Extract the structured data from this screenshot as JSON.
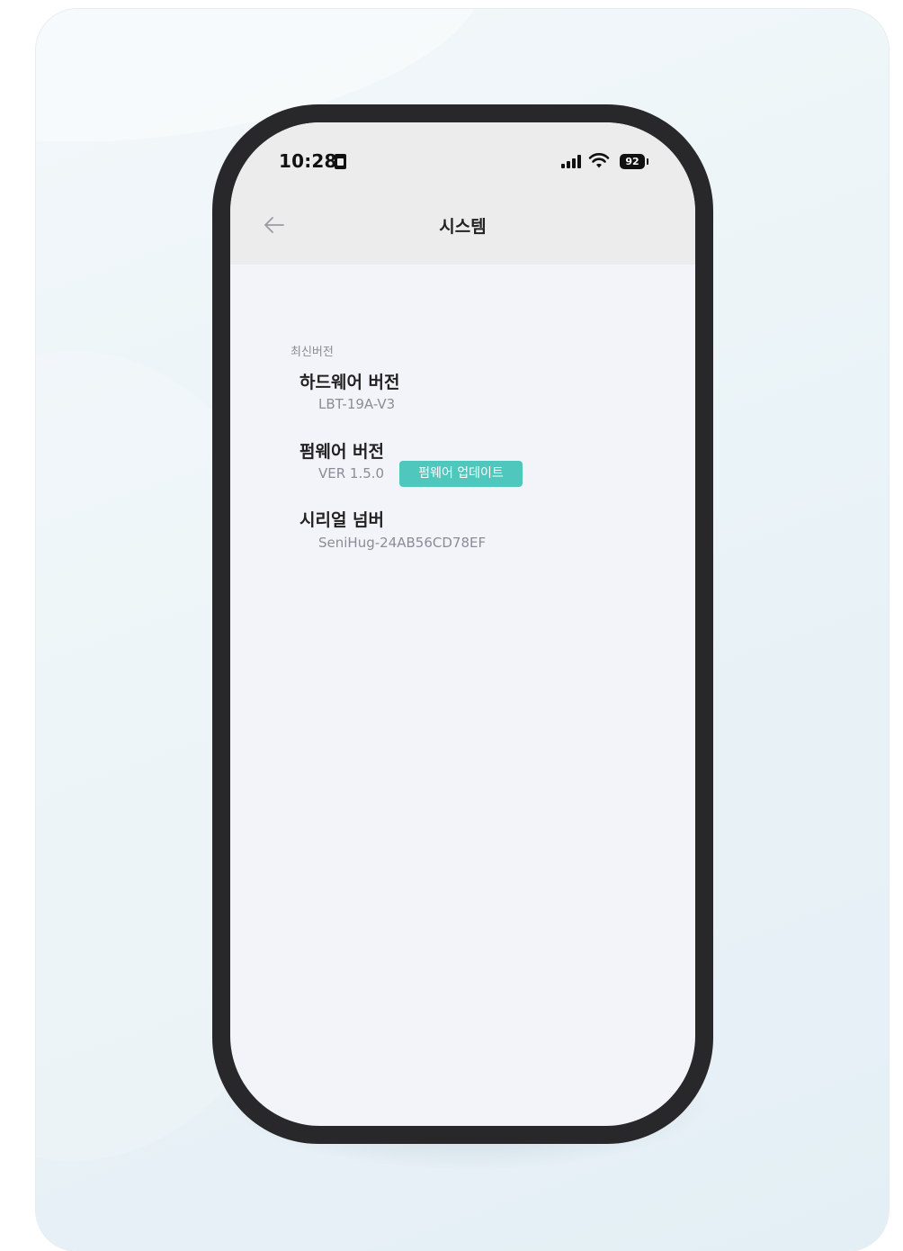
{
  "status_bar": {
    "time": "10:28",
    "battery": "92"
  },
  "header": {
    "title": "시스템"
  },
  "section": {
    "label": "최신버전"
  },
  "items": [
    {
      "title": "하드웨어 버전",
      "value": "LBT-19A-V3"
    },
    {
      "title": "펌웨어 버전",
      "value": "VER 1.5.0",
      "action_label": "펌웨어 업데이트"
    },
    {
      "title": "시리얼 넘버",
      "value": "SeniHug-24AB56CD78EF"
    }
  ],
  "colors": {
    "accent": "#4fc7bd",
    "screen_bg": "#f3f4f9",
    "header_bg": "#ececec",
    "device_frame": "#28282b"
  },
  "icons": {
    "back": "arrow-left-icon",
    "sim": "sim-card-icon",
    "signal": "cellular-signal-icon",
    "wifi": "wifi-icon",
    "battery": "battery-icon"
  }
}
